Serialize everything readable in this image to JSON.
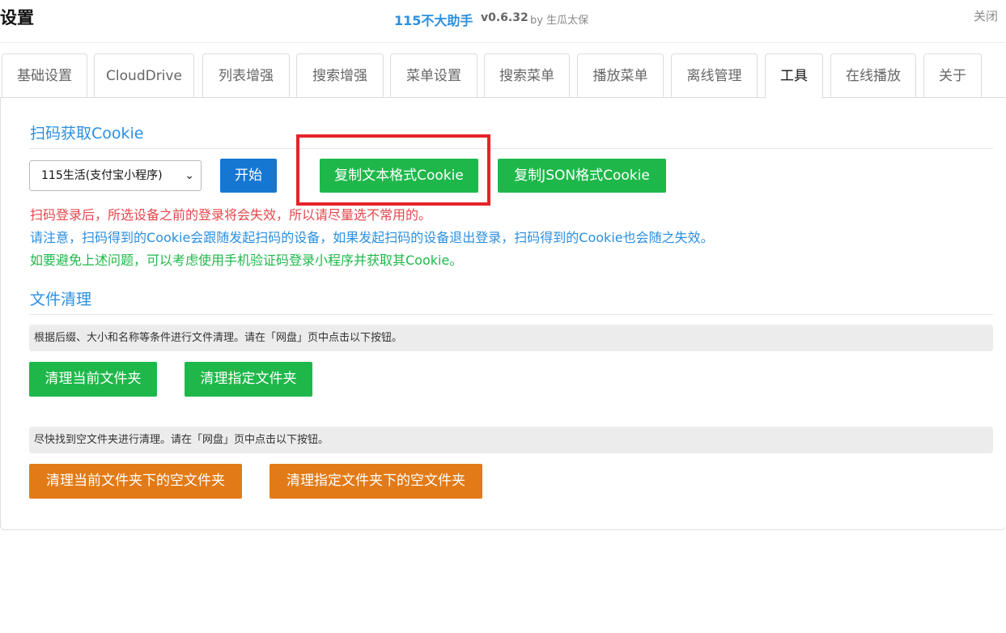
{
  "header": {
    "title": "设置",
    "app_name": "115不大助手",
    "version": "v0.6.32",
    "author": "by 生瓜太保",
    "close_label": "关闭"
  },
  "tabs": [
    {
      "label": "基础设置"
    },
    {
      "label": "CloudDrive"
    },
    {
      "label": "列表增强"
    },
    {
      "label": "搜索增强"
    },
    {
      "label": "菜单设置"
    },
    {
      "label": "搜索菜单"
    },
    {
      "label": "播放菜单"
    },
    {
      "label": "离线管理"
    },
    {
      "label": "工具",
      "active": true
    },
    {
      "label": "在线播放"
    },
    {
      "label": "关于"
    }
  ],
  "cookie_section": {
    "title": "扫码获取Cookie",
    "device_select": {
      "value": "115生活(支付宝小程序)"
    },
    "start_label": "开始",
    "copy_text_label": "复制文本格式Cookie",
    "copy_json_label": "复制JSON格式Cookie",
    "notes": [
      "扫码登录后，所选设备之前的登录将会失效，所以请尽量选不常用的。",
      "请注意，扫码得到的Cookie会跟随发起扫码的设备，如果发起扫码的设备退出登录，扫码得到的Cookie也会随之失效。",
      "如要避免上述问题，可以考虑使用手机验证码登录小程序并获取其Cookie。"
    ]
  },
  "cleanup_section": {
    "title": "文件清理",
    "desc1": "根据后缀、大小和名称等条件进行文件清理。请在「网盘」页中点击以下按钮。",
    "clean_current_label": "清理当前文件夹",
    "clean_specified_label": "清理指定文件夹",
    "desc2": "尽快找到空文件夹进行清理。请在「网盘」页中点击以下按钮。",
    "clean_current_empty_label": "清理当前文件夹下的空文件夹",
    "clean_specified_empty_label": "清理指定文件夹下的空文件夹"
  },
  "colors": {
    "accent_blue": "#2b8fe0",
    "button_blue": "#1677d2",
    "button_green": "#1eb84a",
    "button_orange": "#e27b17",
    "highlight_red": "#e5242a",
    "warning_red": "#e5484d"
  }
}
